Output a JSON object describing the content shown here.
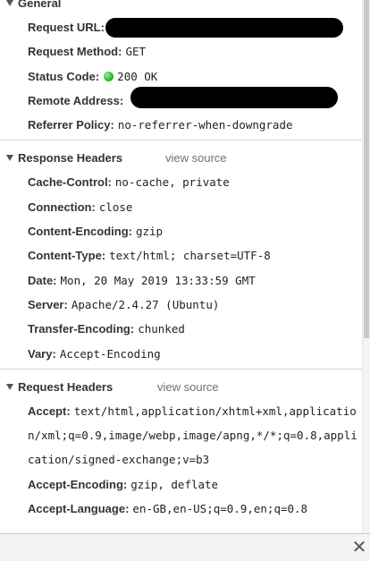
{
  "general": {
    "title": "General",
    "request_url_label": "Request URL:",
    "request_method_label": "Request Method:",
    "request_method_value": "GET",
    "status_code_label": "Status Code:",
    "status_code_value": "200 OK",
    "status_color": "#22aa22",
    "remote_address_label": "Remote Address:",
    "referrer_policy_label": "Referrer Policy:",
    "referrer_policy_value": "no-referrer-when-downgrade"
  },
  "response_headers": {
    "title": "Response Headers",
    "view_source": "view source",
    "rows": [
      {
        "key": "Cache-Control:",
        "value": "no-cache, private"
      },
      {
        "key": "Connection:",
        "value": "close"
      },
      {
        "key": "Content-Encoding:",
        "value": "gzip"
      },
      {
        "key": "Content-Type:",
        "value": "text/html; charset=UTF-8"
      },
      {
        "key": "Date:",
        "value": "Mon, 20 May 2019 13:33:59 GMT"
      },
      {
        "key": "Server:",
        "value": "Apache/2.4.27 (Ubuntu)"
      },
      {
        "key": "Transfer-Encoding:",
        "value": "chunked"
      },
      {
        "key": "Vary:",
        "value": "Accept-Encoding"
      }
    ]
  },
  "request_headers": {
    "title": "Request Headers",
    "view_source": "view source",
    "accept_label": "Accept:",
    "accept_value": "text/html,application/xhtml+xml,application/xml;q=0.9,image/webp,image/apng,*/*;q=0.8,application/signed-exchange;v=b3",
    "accept_encoding_label": "Accept-Encoding:",
    "accept_encoding_value": "gzip, deflate",
    "accept_language_label": "Accept-Language:",
    "accept_language_value": "en-GB,en-US;q=0.9,en;q=0.8"
  },
  "footer": {
    "close_symbol": "✕"
  }
}
